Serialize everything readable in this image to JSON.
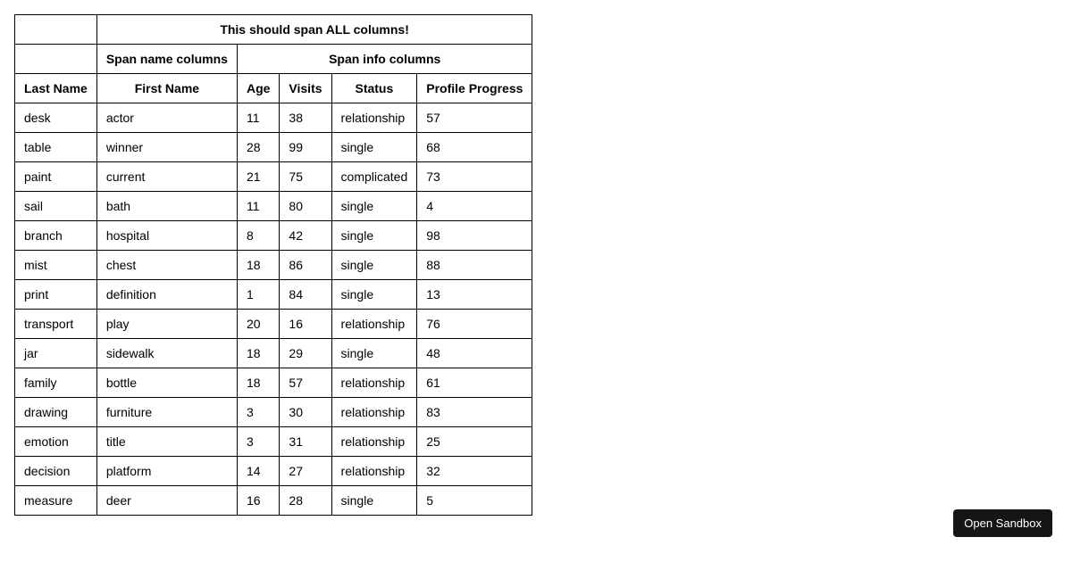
{
  "headers": {
    "span_all": "This should span ALL columns!",
    "span_name": "Span name columns",
    "span_info": "Span info columns",
    "last_name": "Last Name",
    "first_name": "First Name",
    "age": "Age",
    "visits": "Visits",
    "status": "Status",
    "progress": "Profile Progress"
  },
  "rows": [
    {
      "last": "desk",
      "first": "actor",
      "age": 11,
      "visits": 38,
      "status": "relationship",
      "progress": 57
    },
    {
      "last": "table",
      "first": "winner",
      "age": 28,
      "visits": 99,
      "status": "single",
      "progress": 68
    },
    {
      "last": "paint",
      "first": "current",
      "age": 21,
      "visits": 75,
      "status": "complicated",
      "progress": 73
    },
    {
      "last": "sail",
      "first": "bath",
      "age": 11,
      "visits": 80,
      "status": "single",
      "progress": 4
    },
    {
      "last": "branch",
      "first": "hospital",
      "age": 8,
      "visits": 42,
      "status": "single",
      "progress": 98
    },
    {
      "last": "mist",
      "first": "chest",
      "age": 18,
      "visits": 86,
      "status": "single",
      "progress": 88
    },
    {
      "last": "print",
      "first": "definition",
      "age": 1,
      "visits": 84,
      "status": "single",
      "progress": 13
    },
    {
      "last": "transport",
      "first": "play",
      "age": 20,
      "visits": 16,
      "status": "relationship",
      "progress": 76
    },
    {
      "last": "jar",
      "first": "sidewalk",
      "age": 18,
      "visits": 29,
      "status": "single",
      "progress": 48
    },
    {
      "last": "family",
      "first": "bottle",
      "age": 18,
      "visits": 57,
      "status": "relationship",
      "progress": 61
    },
    {
      "last": "drawing",
      "first": "furniture",
      "age": 3,
      "visits": 30,
      "status": "relationship",
      "progress": 83
    },
    {
      "last": "emotion",
      "first": "title",
      "age": 3,
      "visits": 31,
      "status": "relationship",
      "progress": 25
    },
    {
      "last": "decision",
      "first": "platform",
      "age": 14,
      "visits": 27,
      "status": "relationship",
      "progress": 32
    },
    {
      "last": "measure",
      "first": "deer",
      "age": 16,
      "visits": 28,
      "status": "single",
      "progress": 5
    }
  ],
  "button": {
    "open_sandbox": "Open Sandbox"
  }
}
